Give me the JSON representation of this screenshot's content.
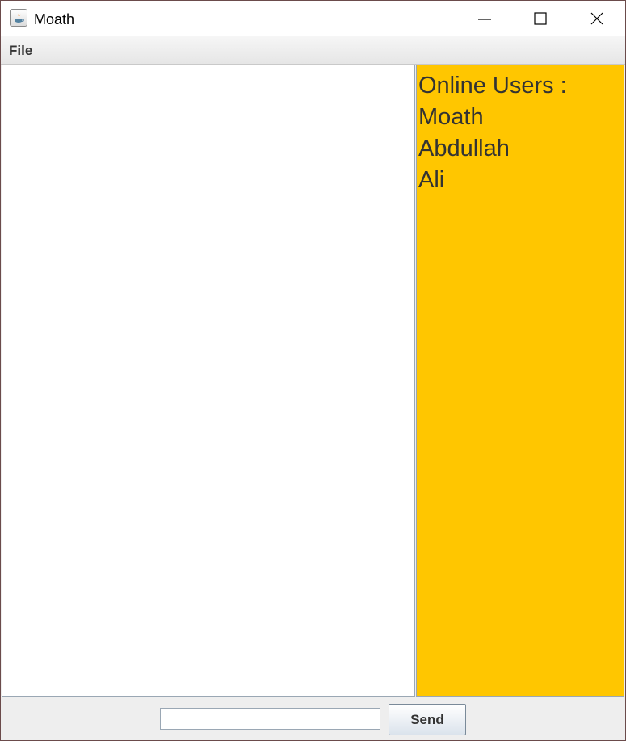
{
  "window": {
    "title": "Moath"
  },
  "menubar": {
    "items": [
      {
        "label": "File"
      }
    ]
  },
  "chat": {
    "messages": []
  },
  "users_panel": {
    "header": "Online Users :",
    "users": [
      "Moath",
      "Abdullah",
      "Ali"
    ],
    "background_color": "#ffc600"
  },
  "composer": {
    "input_value": "",
    "send_label": "Send"
  }
}
